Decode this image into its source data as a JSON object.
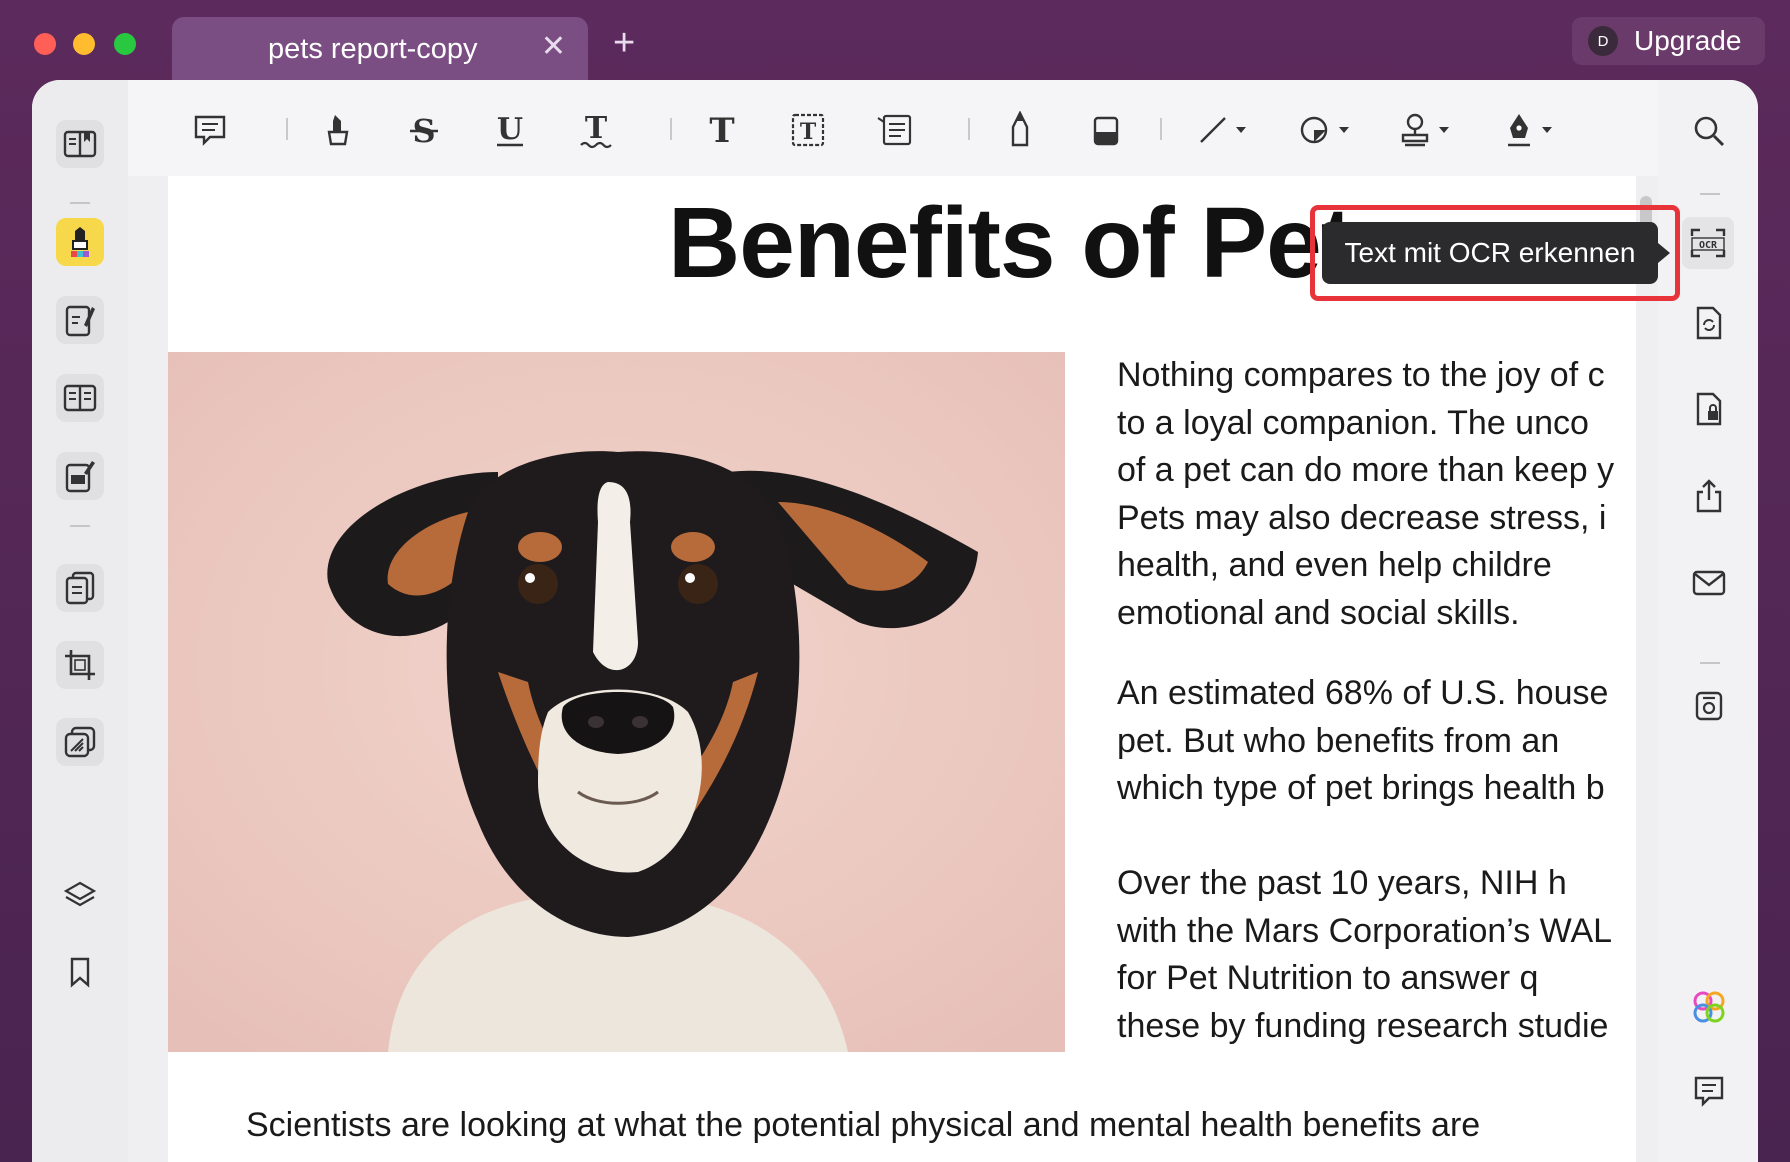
{
  "titlebar": {
    "tab_title": "pets report-copy",
    "tab_close": "✕",
    "tab_add": "+",
    "avatar_initial": "D",
    "upgrade_label": "Upgrade"
  },
  "tooltip": {
    "text": "Text mit OCR erkennen"
  },
  "document": {
    "title": "Benefits of Pets",
    "paragraph1": [
      "Nothing compares to the joy of c",
      "to a loyal companion. The unco",
      "of a pet can do more than keep y",
      "Pets may also decrease stress, i",
      "health,  and  even  help  childre",
      "emotional and social skills."
    ],
    "paragraph2": [
      "An estimated 68% of U.S. house",
      "pet.  But  who  benefits  from  an",
      "which type of pet brings health b"
    ],
    "paragraph3": [
      "Over  the  past  10  years,  NIH  h",
      "with the Mars Corporation’s WAL",
      "for  Pet  Nutrition  to  answer  q",
      "these by funding research studie"
    ],
    "bottom_line": "Scientists are looking at what the potential physical and mental health benefits are"
  },
  "colors": {
    "highlight_active": "#f7d84a",
    "tooltip_bg": "#2b2b2d",
    "tooltip_frame": "#e8333a"
  }
}
